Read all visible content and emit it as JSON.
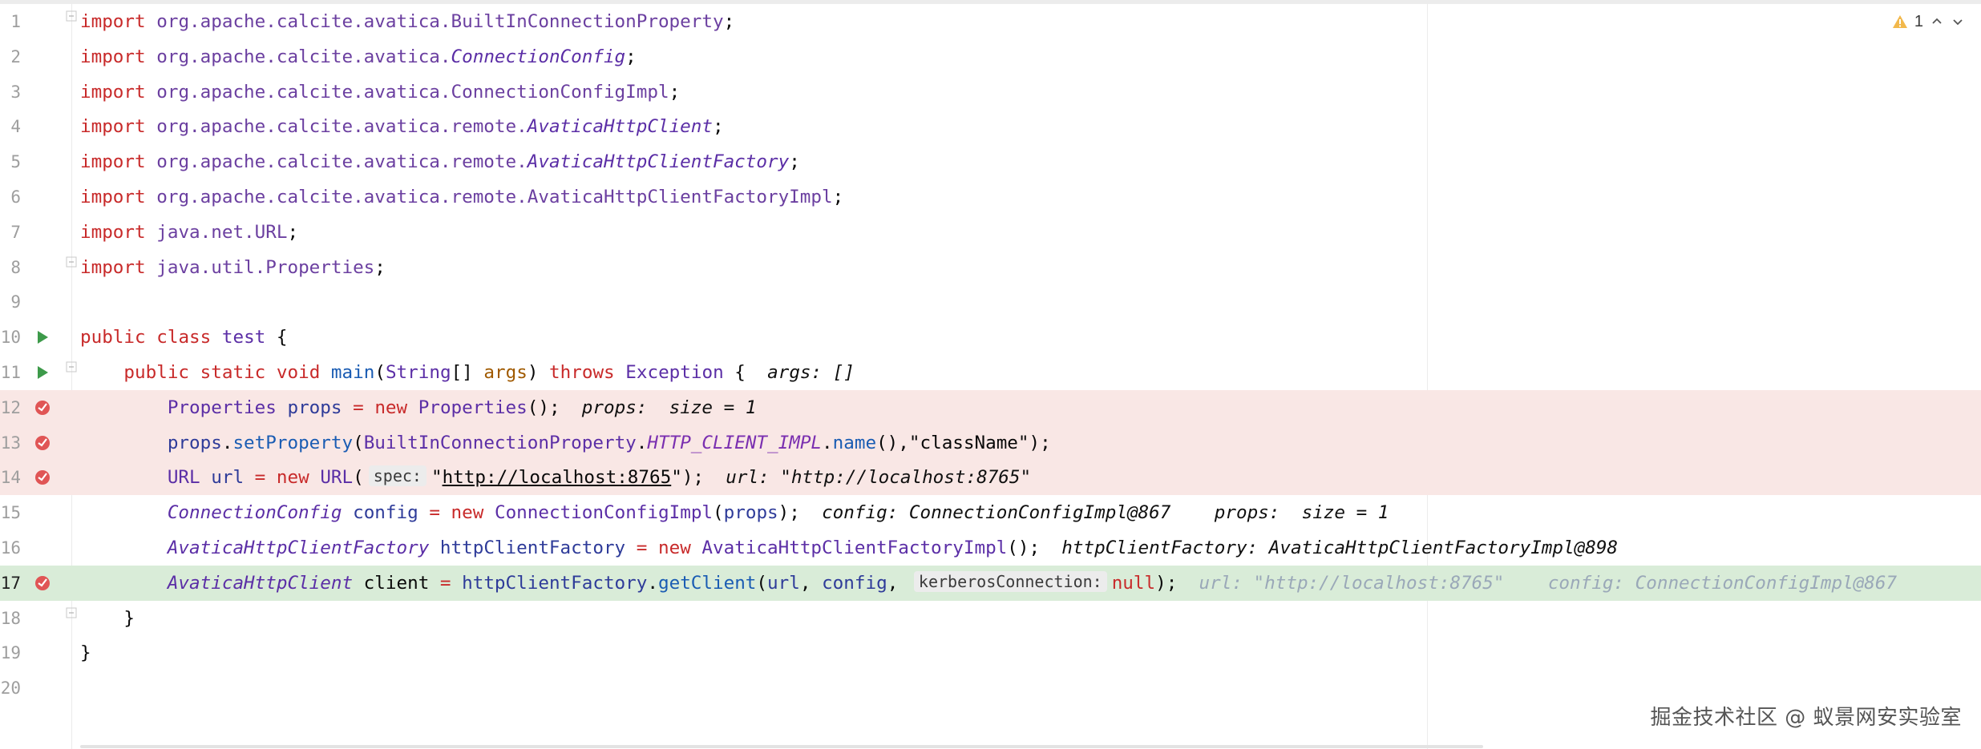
{
  "editor": {
    "inspection_count": "1",
    "lines": [
      {
        "n": "1",
        "tokens": [
          [
            "kw",
            "import"
          ],
          [
            "txt",
            " "
          ],
          [
            "pkg",
            "org.apache.calcite.avatica.BuiltInConnectionProperty"
          ],
          [
            "txt",
            ";"
          ]
        ]
      },
      {
        "n": "2",
        "tokens": [
          [
            "kw",
            "import"
          ],
          [
            "txt",
            " "
          ],
          [
            "pkg",
            "org.apache.calcite.avatica."
          ],
          [
            "cls it",
            "ConnectionConfig"
          ],
          [
            "txt",
            ";"
          ]
        ]
      },
      {
        "n": "3",
        "tokens": [
          [
            "kw",
            "import"
          ],
          [
            "txt",
            " "
          ],
          [
            "pkg",
            "org.apache.calcite.avatica.ConnectionConfigImpl"
          ],
          [
            "txt",
            ";"
          ]
        ]
      },
      {
        "n": "4",
        "tokens": [
          [
            "kw",
            "import"
          ],
          [
            "txt",
            " "
          ],
          [
            "pkg",
            "org.apache.calcite.avatica.remote."
          ],
          [
            "cls it",
            "AvaticaHttpClient"
          ],
          [
            "txt",
            ";"
          ]
        ]
      },
      {
        "n": "5",
        "tokens": [
          [
            "kw",
            "import"
          ],
          [
            "txt",
            " "
          ],
          [
            "pkg",
            "org.apache.calcite.avatica.remote."
          ],
          [
            "cls it",
            "AvaticaHttpClientFactory"
          ],
          [
            "txt",
            ";"
          ]
        ]
      },
      {
        "n": "6",
        "tokens": [
          [
            "kw",
            "import"
          ],
          [
            "txt",
            " "
          ],
          [
            "pkg",
            "org.apache.calcite.avatica.remote.AvaticaHttpClientFactoryImpl"
          ],
          [
            "txt",
            ";"
          ]
        ]
      },
      {
        "n": "7",
        "tokens": [
          [
            "kw",
            "import"
          ],
          [
            "txt",
            " "
          ],
          [
            "pkg",
            "java.net.URL"
          ],
          [
            "txt",
            ";"
          ]
        ]
      },
      {
        "n": "8",
        "tokens": [
          [
            "kw",
            "import"
          ],
          [
            "txt",
            " "
          ],
          [
            "pkg",
            "java.util.Properties"
          ],
          [
            "txt",
            ";"
          ]
        ]
      },
      {
        "n": "9",
        "tokens": []
      },
      {
        "n": "10",
        "tokens": [
          [
            "kw",
            "public"
          ],
          [
            "txt",
            " "
          ],
          [
            "kw",
            "class"
          ],
          [
            "txt",
            " "
          ],
          [
            "cls",
            "test"
          ],
          [
            "txt",
            " {"
          ]
        ]
      },
      {
        "n": "11",
        "tokens": [
          [
            "txt",
            "    "
          ],
          [
            "kw",
            "public"
          ],
          [
            "txt",
            " "
          ],
          [
            "kw",
            "static"
          ],
          [
            "txt",
            " "
          ],
          [
            "kw",
            "void"
          ],
          [
            "txt",
            " "
          ],
          [
            "fn",
            "main"
          ],
          [
            "txt",
            "("
          ],
          [
            "cls",
            "String"
          ],
          [
            "txt",
            "[] "
          ],
          [
            "param",
            "args"
          ],
          [
            "txt",
            ") "
          ],
          [
            "kw",
            "throws"
          ],
          [
            "txt",
            " "
          ],
          [
            "cls",
            "Exception"
          ],
          [
            "txt",
            " {  "
          ],
          [
            "dbg",
            "args: []"
          ]
        ]
      },
      {
        "n": "12",
        "tokens": [
          [
            "txt",
            "        "
          ],
          [
            "cls",
            "Properties"
          ],
          [
            "txt",
            " "
          ],
          [
            "var",
            "props"
          ],
          [
            "txt",
            " "
          ],
          [
            "kw",
            "="
          ],
          [
            "txt",
            " "
          ],
          [
            "kw",
            "new"
          ],
          [
            "txt",
            " "
          ],
          [
            "cls",
            "Properties"
          ],
          [
            "txt",
            "();  "
          ],
          [
            "dbg",
            "props:  size = 1"
          ]
        ]
      },
      {
        "n": "13",
        "tokens": [
          [
            "txt",
            "        "
          ],
          [
            "var",
            "props"
          ],
          [
            "txt",
            "."
          ],
          [
            "fn",
            "setProperty"
          ],
          [
            "txt",
            "("
          ],
          [
            "cls",
            "BuiltInConnectionProperty"
          ],
          [
            "txt",
            "."
          ],
          [
            "field it",
            "HTTP_CLIENT_IMPL"
          ],
          [
            "txt",
            "."
          ],
          [
            "fn",
            "name"
          ],
          [
            "txt",
            "(),\"className\");"
          ]
        ]
      },
      {
        "n": "14",
        "tokens": [
          [
            "txt",
            "        "
          ],
          [
            "cls",
            "URL"
          ],
          [
            "txt",
            " "
          ],
          [
            "var",
            "url"
          ],
          [
            "txt",
            " "
          ],
          [
            "kw",
            "="
          ],
          [
            "txt",
            " "
          ],
          [
            "kw",
            "new"
          ],
          [
            "txt",
            " "
          ],
          [
            "cls",
            "URL"
          ],
          [
            "txt",
            "("
          ],
          [
            "hint",
            "spec:"
          ],
          [
            "txt",
            "\""
          ],
          [
            "ul",
            "http://localhost:8765"
          ],
          [
            "txt",
            "\");  "
          ],
          [
            "dbg",
            "url: \"http://localhost:8765\""
          ]
        ]
      },
      {
        "n": "15",
        "tokens": [
          [
            "txt",
            "        "
          ],
          [
            "cls it",
            "ConnectionConfig"
          ],
          [
            "txt",
            " "
          ],
          [
            "var",
            "config"
          ],
          [
            "txt",
            " "
          ],
          [
            "kw",
            "="
          ],
          [
            "txt",
            " "
          ],
          [
            "kw",
            "new"
          ],
          [
            "txt",
            " "
          ],
          [
            "cls",
            "ConnectionConfigImpl"
          ],
          [
            "txt",
            "("
          ],
          [
            "var",
            "props"
          ],
          [
            "txt",
            ");  "
          ],
          [
            "dbg",
            "config: ConnectionConfigImpl@867    props:  size = 1"
          ]
        ]
      },
      {
        "n": "16",
        "tokens": [
          [
            "txt",
            "        "
          ],
          [
            "cls it",
            "AvaticaHttpClientFactory"
          ],
          [
            "txt",
            " "
          ],
          [
            "var",
            "httpClientFactory"
          ],
          [
            "txt",
            " "
          ],
          [
            "kw",
            "="
          ],
          [
            "txt",
            " "
          ],
          [
            "kw",
            "new"
          ],
          [
            "txt",
            " "
          ],
          [
            "cls",
            "AvaticaHttpClientFactoryImpl"
          ],
          [
            "txt",
            "();  "
          ],
          [
            "dbg",
            "httpClientFactory: AvaticaHttpClientFactoryImpl@898"
          ]
        ]
      },
      {
        "n": "17",
        "tokens": [
          [
            "txt",
            "        "
          ],
          [
            "cls it",
            "AvaticaHttpClient"
          ],
          [
            "txt",
            " client "
          ],
          [
            "kw",
            "="
          ],
          [
            "txt",
            " "
          ],
          [
            "var",
            "httpClientFactory"
          ],
          [
            "txt",
            "."
          ],
          [
            "fn",
            "getClient"
          ],
          [
            "txt",
            "("
          ],
          [
            "var",
            "url"
          ],
          [
            "txt",
            ", "
          ],
          [
            "var",
            "config"
          ],
          [
            "txt",
            ", "
          ],
          [
            "hint",
            "kerberosConnection:"
          ],
          [
            "kw",
            "null"
          ],
          [
            "txt",
            ");  "
          ],
          [
            "dbg-dim",
            "url: \"http://localhost:8765\"    config: ConnectionConfigImpl@867"
          ]
        ]
      },
      {
        "n": "18",
        "tokens": [
          [
            "txt",
            "    }"
          ]
        ]
      },
      {
        "n": "19",
        "tokens": [
          [
            "txt",
            "}"
          ]
        ]
      },
      {
        "n": "20",
        "tokens": []
      }
    ]
  },
  "watermark": "掘金技术社区 @ 蚁景网安实验室"
}
